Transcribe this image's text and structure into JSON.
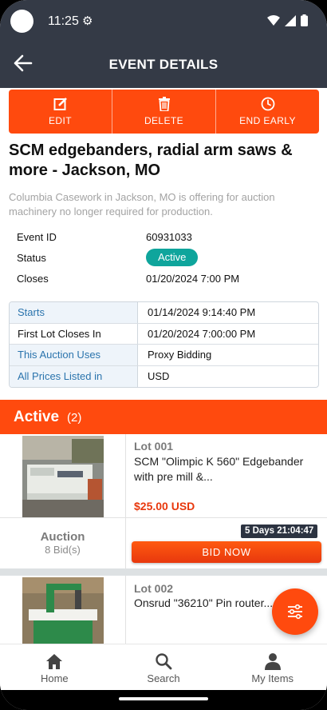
{
  "status_bar": {
    "time": "11:25"
  },
  "header": {
    "title": "EVENT DETAILS"
  },
  "actions": {
    "edit": "EDIT",
    "delete": "DELETE",
    "end_early": "END EARLY"
  },
  "event": {
    "title": "SCM edgebanders, radial arm saws & more - Jackson, MO",
    "description": "Columbia Casework in Jackson, MO is offering for auction machinery no longer required for production."
  },
  "info": {
    "event_id_label": "Event ID",
    "event_id": "60931033",
    "status_label": "Status",
    "status": "Active",
    "closes_label": "Closes",
    "closes": "01/20/2024 7:00 PM"
  },
  "details": [
    {
      "label": "Starts",
      "value": "01/14/2024 9:14:40 PM"
    },
    {
      "label": "First Lot Closes In",
      "value": "01/20/2024 7:00:00 PM"
    },
    {
      "label": "This Auction Uses",
      "value": "Proxy Bidding"
    },
    {
      "label": "All Prices Listed in",
      "value": "USD"
    }
  ],
  "active_section": {
    "label": "Active",
    "count": "(2)"
  },
  "lots": [
    {
      "number": "Lot 001",
      "title": "SCM \"Olimpic K 560\" Edgebander with pre mill &...",
      "price": "$25.00 USD",
      "type": "Auction",
      "bids": "8 Bid(s)",
      "countdown": "5 Days 21:04:47",
      "bid_label": "BID NOW"
    },
    {
      "number": "Lot 002",
      "title": "Onsrud \"36210\" Pin router..."
    }
  ],
  "tabs": [
    {
      "label": "Home"
    },
    {
      "label": "Search"
    },
    {
      "label": "My Items"
    }
  ],
  "colors": {
    "brand": "#ff4a0e",
    "header_bg": "#343a46",
    "status_badge": "#0fa59c",
    "price": "#e8380d"
  }
}
